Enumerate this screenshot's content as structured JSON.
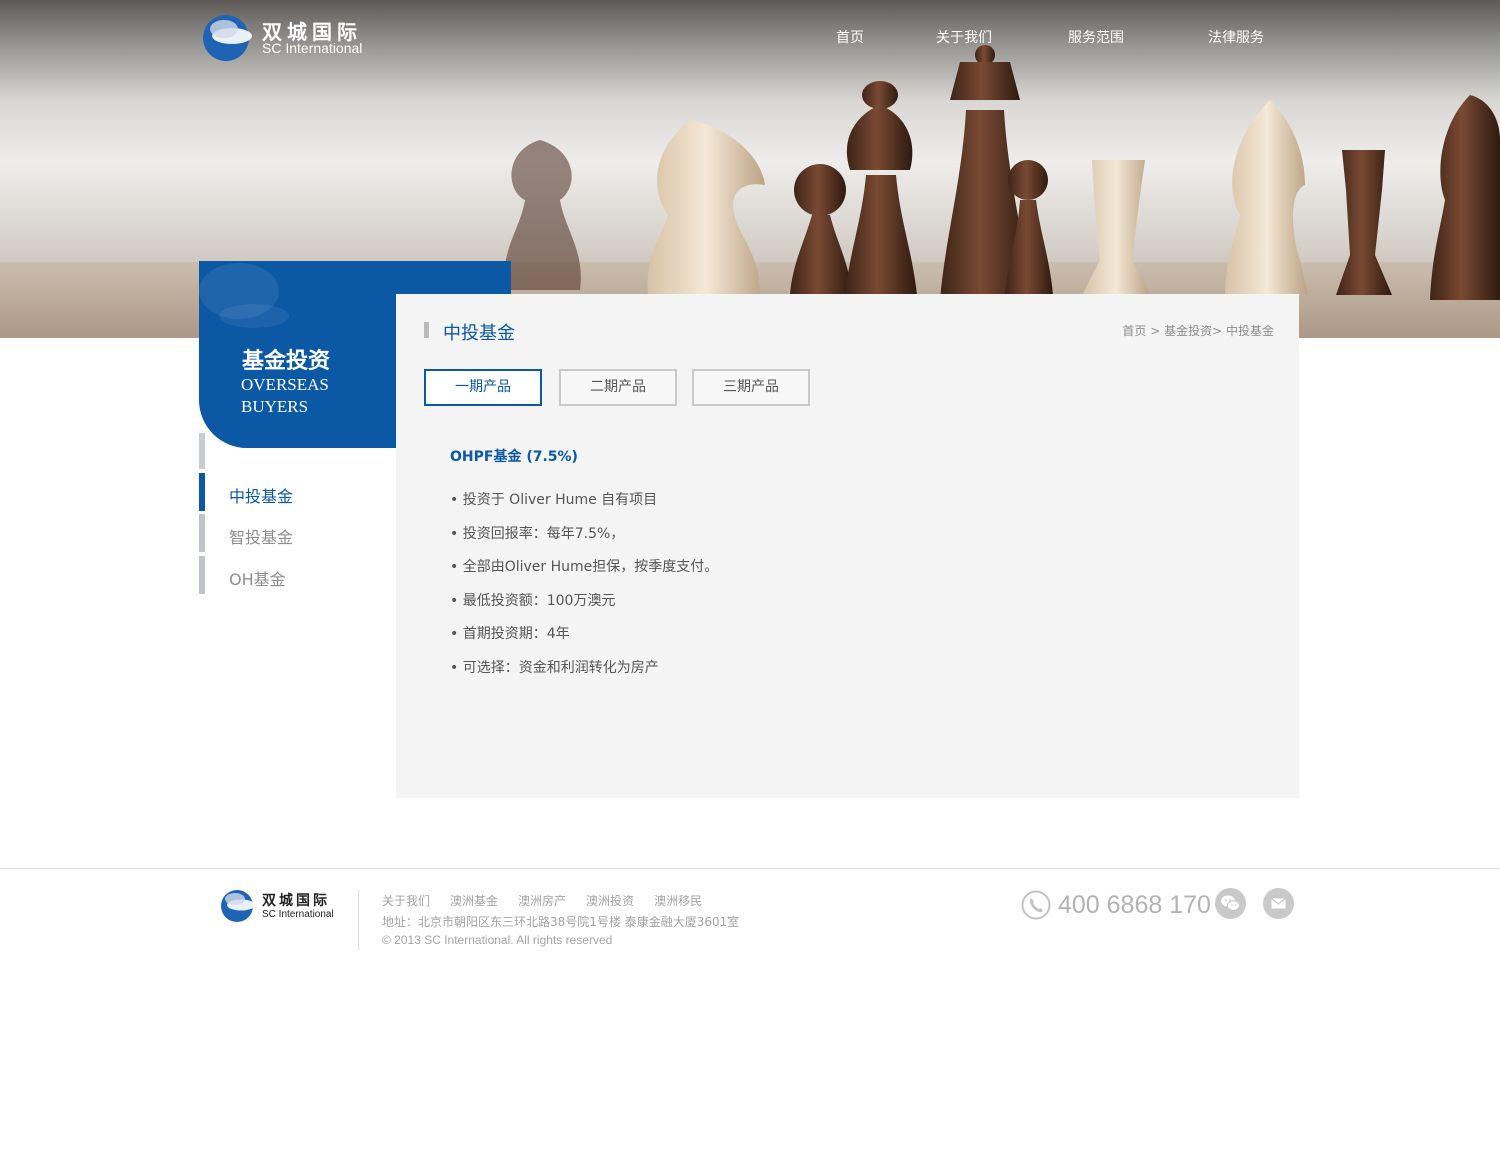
{
  "brand": {
    "name_cn": "双城国际",
    "name_en": "SC International"
  },
  "nav": {
    "items": [
      "首页",
      "关于我们",
      "服务范围",
      "法律服务"
    ]
  },
  "sidebar": {
    "title": "基金投资",
    "subtitle_line1": "OVERSEAS",
    "subtitle_line2": "BUYERS",
    "items": [
      {
        "label": "中投基金",
        "active": true
      },
      {
        "label": "智投基金",
        "active": false
      },
      {
        "label": "OH基金",
        "active": false
      }
    ]
  },
  "content": {
    "title": "中投基金",
    "breadcrumb": {
      "home": "首页",
      "sep1": " > ",
      "level1": "基金投资",
      "sep2": "> ",
      "current": "中投基金"
    },
    "tabs": [
      {
        "label": "一期产品",
        "active": true
      },
      {
        "label": "二期产品",
        "active": false
      },
      {
        "label": "三期产品",
        "active": false
      }
    ],
    "product_title": "OHPF基金 (7.5%)",
    "bullets": [
      "投资于 Oliver Hume 自有项目",
      "投资回报率：每年7.5%，",
      "全部由Oliver Hume担保，按季度支付。",
      "最低投资额：100万澳元",
      "首期投资期：4年",
      "可选择：资金和利润转化为房产"
    ]
  },
  "footer": {
    "links": [
      "关于我们",
      "澳洲基金",
      "澳洲房产",
      "澳洲投资",
      "澳洲移民"
    ],
    "address": "地址：北京市朝阳区东三环北路38号院1号楼 泰康金融大厦3601室",
    "copyright": "© 2013 SC International. All rights reserved",
    "phone": "400 6868 170",
    "icons": [
      "phone-icon",
      "wechat-icon",
      "mail-icon"
    ]
  },
  "colors": {
    "brand_blue": "#0b58a4",
    "panel_bg": "#f4f4f4",
    "muted_text": "#a3a3a3"
  }
}
